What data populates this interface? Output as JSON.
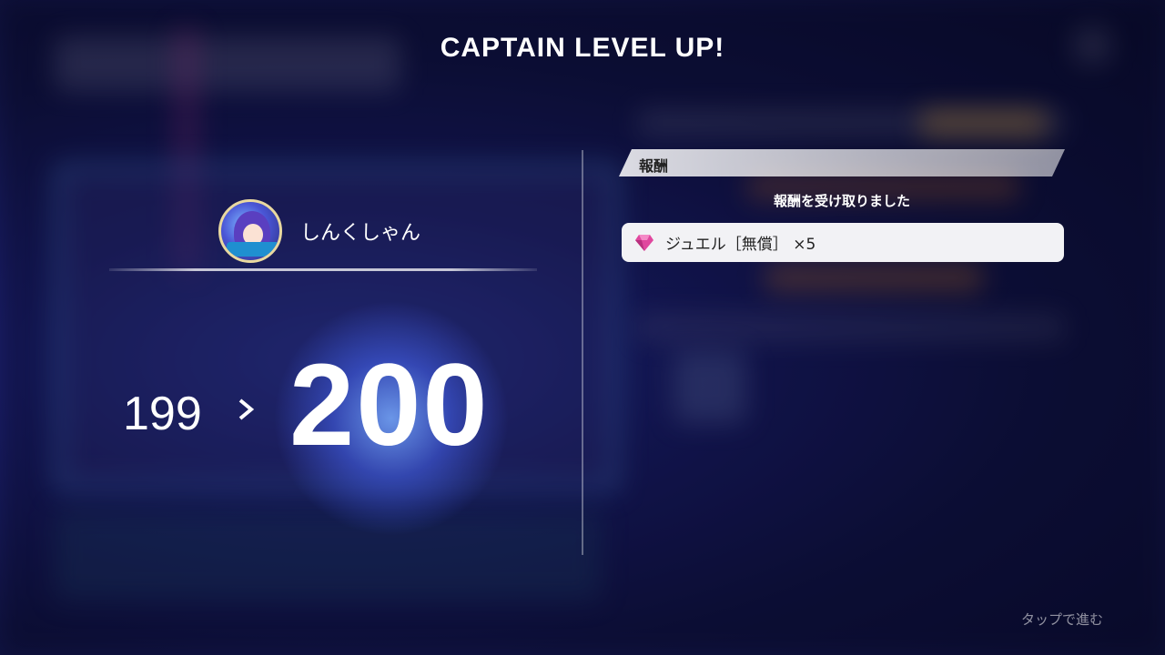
{
  "title": "CAPTAIN LEVEL UP!",
  "captain": {
    "name": "しんくしゃん",
    "level_before": "199",
    "level_after": "200"
  },
  "reward": {
    "header": "報酬",
    "status": "報酬を受け取りました",
    "items": [
      {
        "icon": "jewel-gem-icon",
        "label": "ジュエル［無償］ ×5"
      }
    ]
  },
  "footer": {
    "tap_hint": "タップで進む"
  },
  "colors": {
    "gem": "#e0479e",
    "panel": "#f2f2f5",
    "background": "#121545"
  }
}
